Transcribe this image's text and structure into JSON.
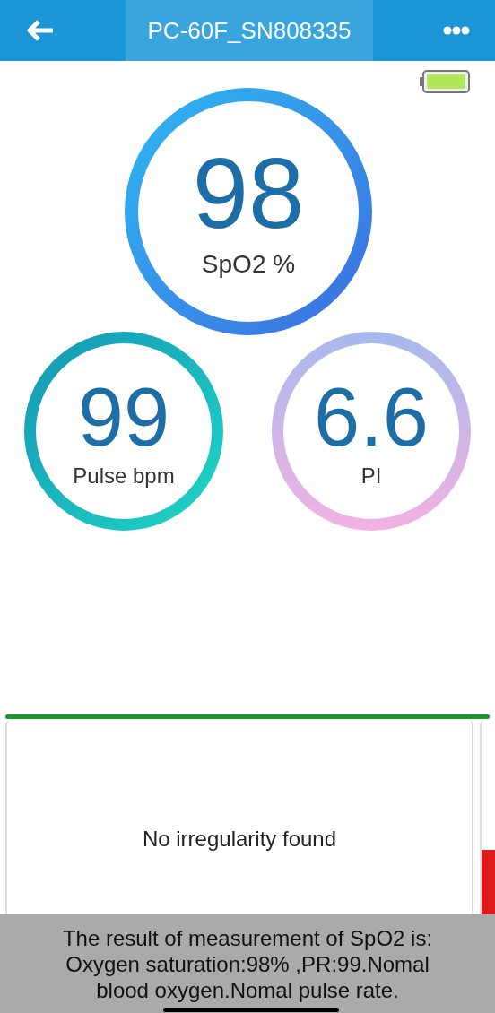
{
  "header": {
    "title": "PC-60F_SN808335"
  },
  "gauges": [
    {
      "kind": "spo2",
      "value": "98",
      "label": "SpO2 %"
    },
    {
      "kind": "pulse",
      "value": "99",
      "label": "Pulse bpm"
    },
    {
      "kind": "pi",
      "value": "6.6",
      "label": "PI"
    }
  ],
  "result_card": {
    "message": "No irregularity found"
  },
  "summary": "The result of measurement of SpO2 is: Oxygen saturation:98% ,PR:99.Nomal blood oxygen.Nomal pulse rate."
}
